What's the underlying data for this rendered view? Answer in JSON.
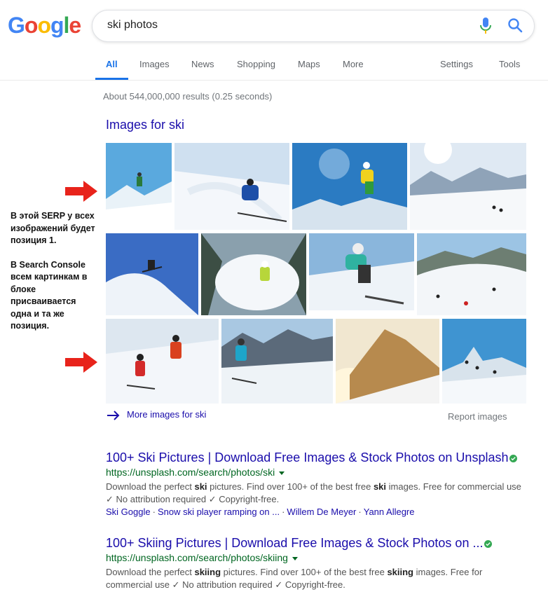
{
  "search": {
    "query": "ski photos"
  },
  "tabs": [
    {
      "label": "All"
    },
    {
      "label": "Images"
    },
    {
      "label": "News"
    },
    {
      "label": "Shopping"
    },
    {
      "label": "Maps"
    },
    {
      "label": "More"
    },
    {
      "label": "Settings"
    },
    {
      "label": "Tools"
    }
  ],
  "stats": "About 544,000,000 results (0.25 seconds)",
  "images_block": {
    "heading": "Images for ski",
    "more_label": "More images for ski",
    "report_label": "Report images"
  },
  "annotation": {
    "para1": "В этой SERP у всех изображений будет позиция 1.",
    "para2": "В Search Console всем картинкам в блоке присваивается одна и та же позиция."
  },
  "results": [
    {
      "title": "100+ Ski Pictures | Download Free Images & Stock Photos on Unsplash",
      "url": "https://unsplash.com/search/photos/ski",
      "snippet_parts": [
        "Download the perfect ",
        "ski",
        " pictures. Find over 100+ of the best free ",
        "ski",
        " images. Free for commercial use ✓ No attribution required ✓ Copyright-free."
      ],
      "sitelinks": [
        "Ski Goggle",
        "Snow ski player ramping on ...",
        "Willem De Meyer",
        "Yann Allegre"
      ]
    },
    {
      "title": "100+ Skiing Pictures | Download Free Images & Stock Photos on ...",
      "url": "https://unsplash.com/search/photos/skiing",
      "snippet_parts": [
        "Download the perfect ",
        "skiing",
        " pictures. Find over 100+ of the best free ",
        "skiing",
        " images. Free for commercial use ✓ No attribution required ✓ Copyright-free."
      ]
    }
  ],
  "colors": {
    "accent": "#1a73e8",
    "link": "#1a0dab",
    "url_green": "#006621",
    "arrow_red": "#e8231b",
    "logo_blue": "#4285f4",
    "logo_red": "#ea4335",
    "logo_yellow": "#fbbc05",
    "logo_green": "#34a853"
  },
  "icons": [
    "mic-icon",
    "search-icon",
    "arrow-right-icon",
    "verified-check-icon",
    "dropdown-triangle-icon"
  ]
}
